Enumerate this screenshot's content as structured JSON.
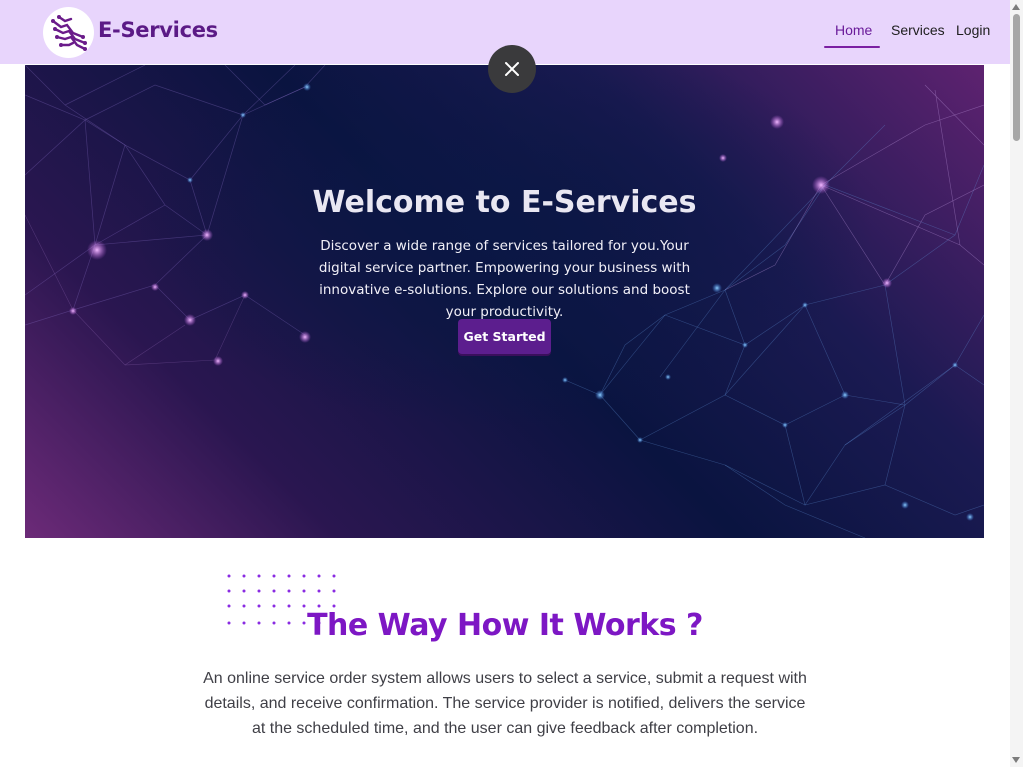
{
  "navbar": {
    "brand": "E-Services",
    "logo_icon": "circuit-hand-logo",
    "links": [
      {
        "label": "Home",
        "active": true
      },
      {
        "label": "Services",
        "active": false
      },
      {
        "label": "Login",
        "active": false
      }
    ],
    "background": "#e8d5fc",
    "accent": "#5b1a86"
  },
  "overlay": {
    "close_icon": "close-icon"
  },
  "hero": {
    "title": "Welcome to E-Services",
    "description": "Discover a wide range of services tailored for you.Your digital service partner. Empowering your business with innovative e-solutions. Explore our solutions and boost your productivity.",
    "cta_label": "Get Started",
    "cta_color": "#5c1e8e"
  },
  "how_it_works": {
    "title": "The Way How It Works ?",
    "description": "An online service order system allows users to select a service, submit a request with details, and receive confirmation. The service provider is notified, delivers the service at the scheduled time, and the user can give feedback after completion.",
    "title_color": "#7d17c4"
  }
}
